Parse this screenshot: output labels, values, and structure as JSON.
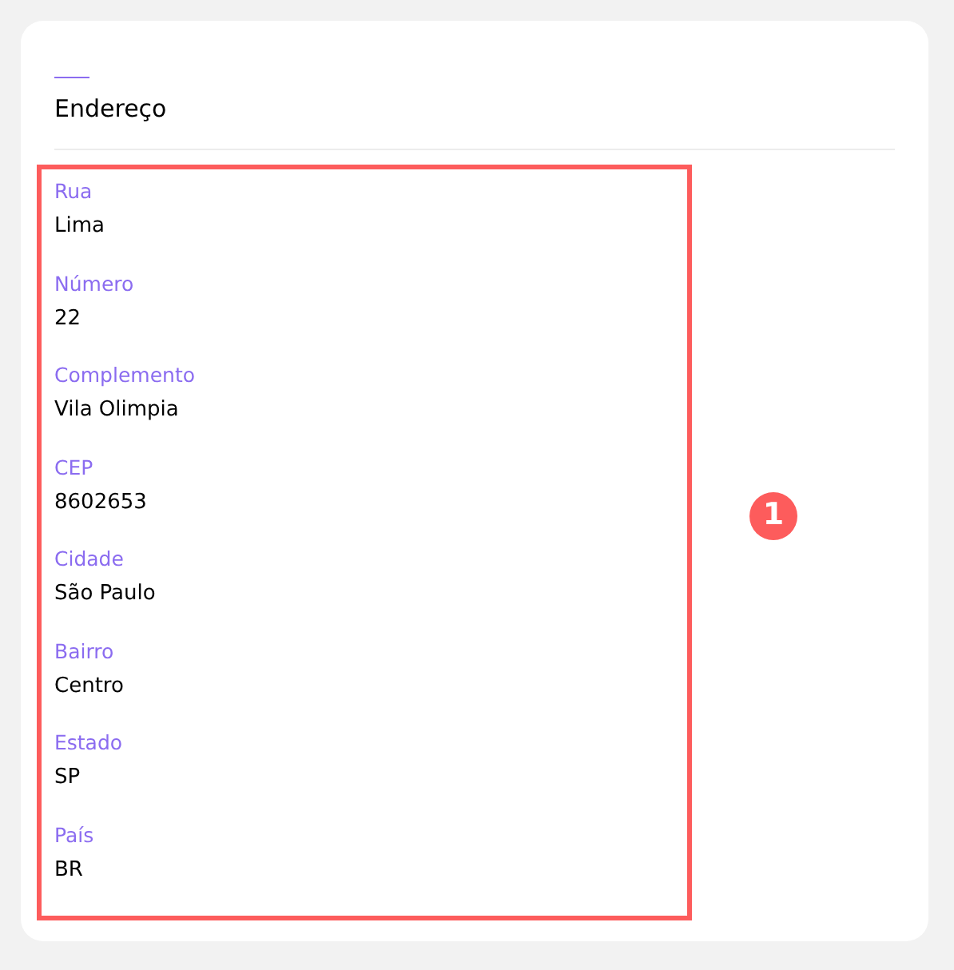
{
  "section": {
    "title": "Endereço"
  },
  "fields": [
    {
      "label": "Rua",
      "value": "Lima"
    },
    {
      "label": "Número",
      "value": "22"
    },
    {
      "label": "Complemento",
      "value": "Vila Olimpia"
    },
    {
      "label": "CEP",
      "value": "8602653"
    },
    {
      "label": "Cidade",
      "value": "São Paulo"
    },
    {
      "label": "Bairro",
      "value": "Centro"
    },
    {
      "label": "Estado",
      "value": "SP"
    },
    {
      "label": "País",
      "value": "BR"
    }
  ],
  "annotation": {
    "badge": "1"
  }
}
